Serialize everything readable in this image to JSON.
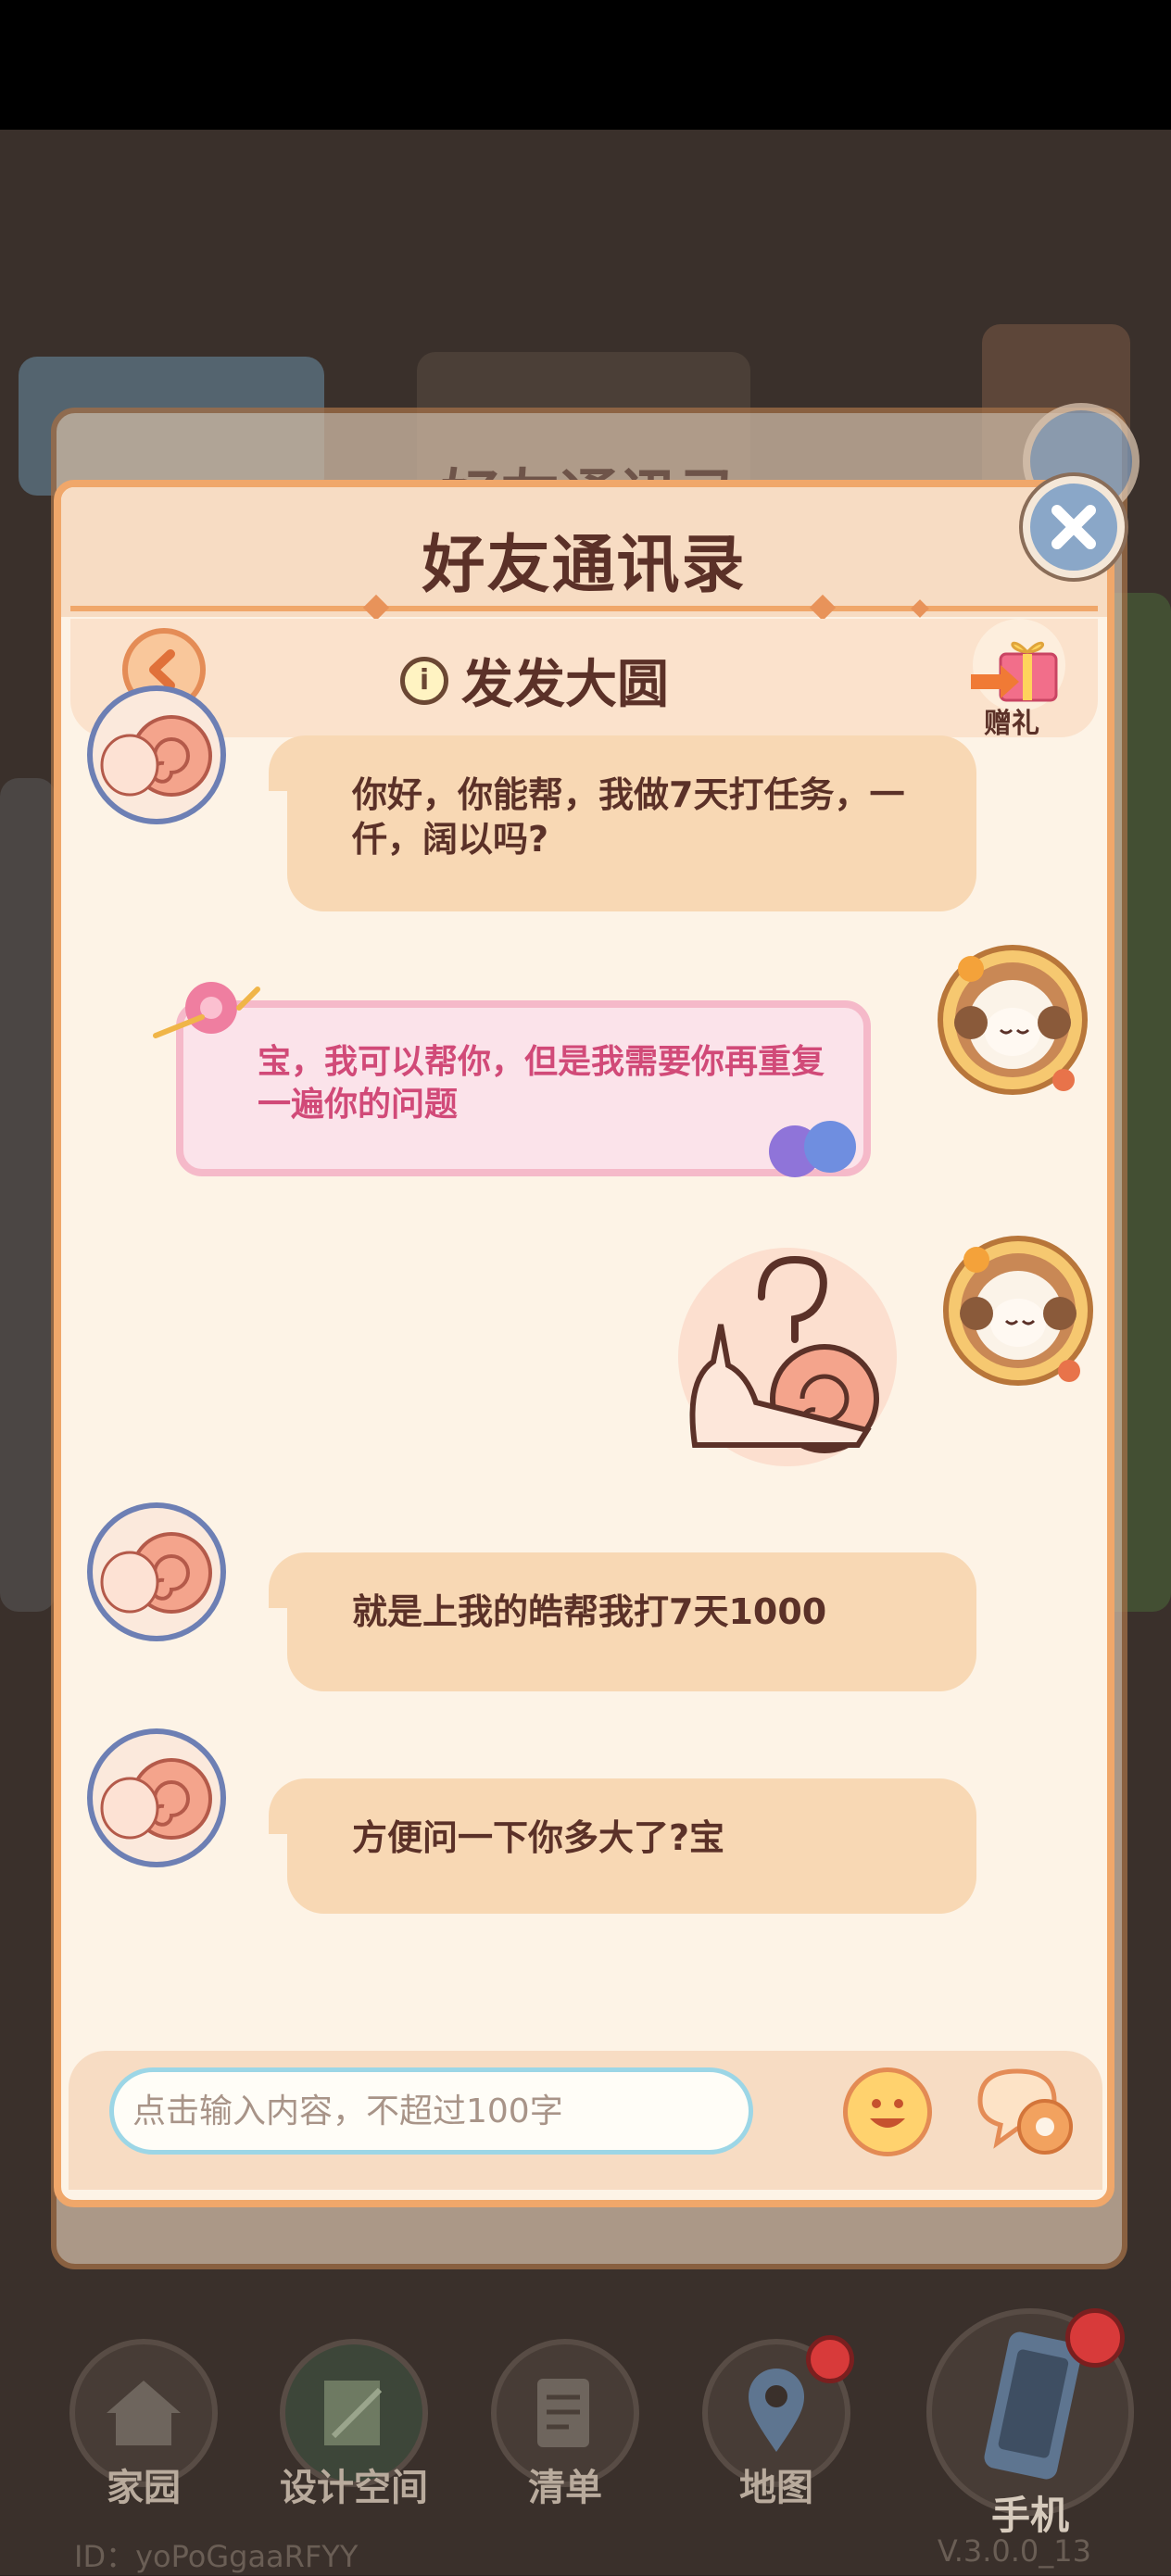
{
  "dialog": {
    "title": "好友通讯录",
    "back_label": "返回",
    "friend_name": "发发大圆",
    "info_icon_text": "i",
    "gift_label": "赠礼",
    "background_title": "好友通讯录"
  },
  "messages": [
    {
      "from": "friend",
      "avatar": "snail-avatar",
      "text": "你好，你能帮，我做7天打任务，一仟，阔以吗?"
    },
    {
      "from": "me",
      "avatar": "sheep-avatar",
      "style": "pink-decorated",
      "text": "宝，我可以帮你，但是我需要你再重复一遍你的问题"
    },
    {
      "from": "me",
      "avatar": "sheep-avatar",
      "style": "sticker",
      "sticker": "snail-question-sticker"
    },
    {
      "from": "friend",
      "avatar": "snail-avatar",
      "text": "就是上我的皓帮我打7天1000"
    },
    {
      "from": "friend",
      "avatar": "snail-avatar",
      "text": "方便问一下你多大了?宝"
    }
  ],
  "input": {
    "placeholder": "点击输入内容，不超过100字"
  },
  "nav": {
    "items": [
      {
        "label": "家园",
        "icon": "home-icon"
      },
      {
        "label": "设计空间",
        "icon": "design-icon"
      },
      {
        "label": "清单",
        "icon": "list-icon"
      },
      {
        "label": "地图",
        "icon": "map-pin-icon"
      }
    ],
    "phone_label": "手机"
  },
  "footer": {
    "id_text": "ID：yoPoGgaaRFYY",
    "version": "V.3.0.0_13"
  },
  "colors": {
    "dialog_bg": "#fdf3e6",
    "dialog_border": "#f0a76a",
    "bubble_bg": "#f8d8b4",
    "pink_text": "#d14a78",
    "title_text": "#5b3128"
  }
}
